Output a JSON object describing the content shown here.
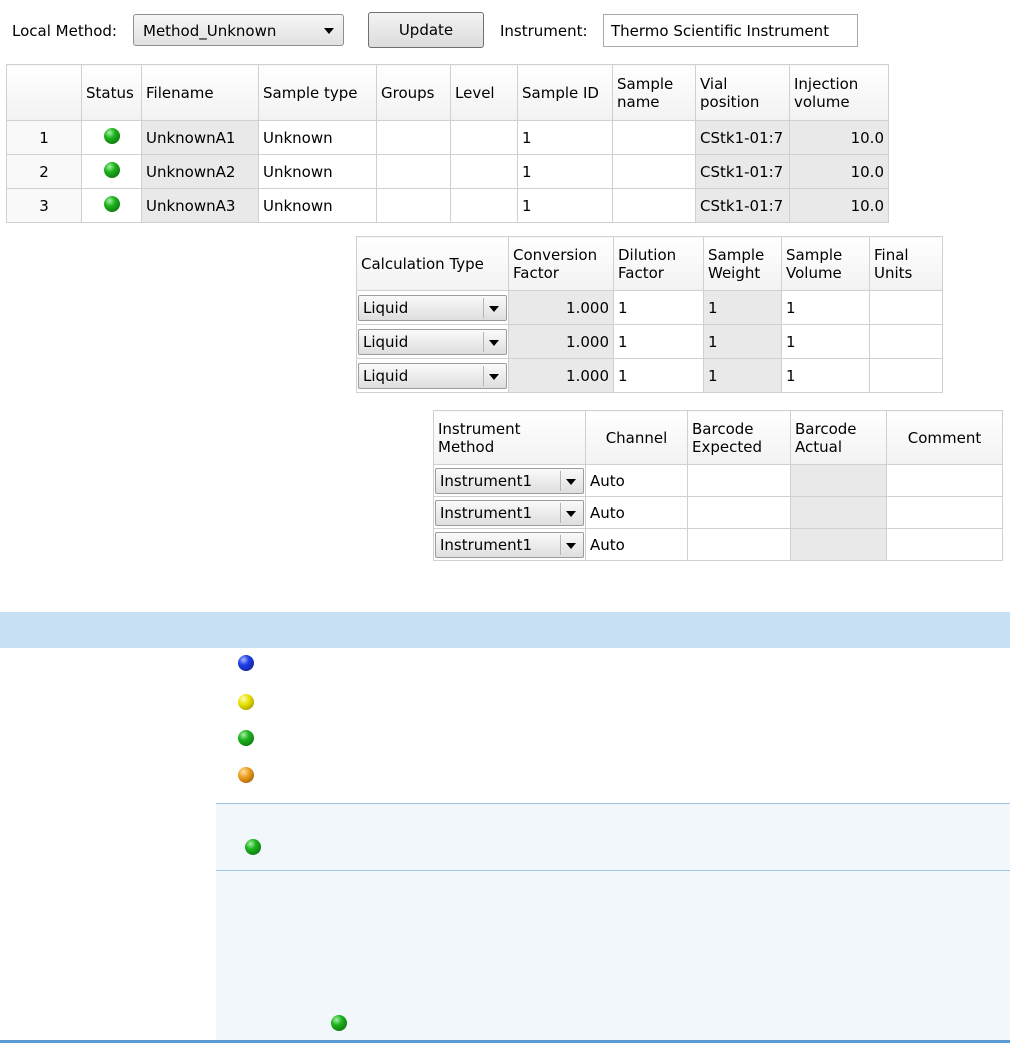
{
  "toolbar": {
    "local_method_label": "Local Method:",
    "local_method_value": "Method_Unknown",
    "update_label": "Update",
    "instrument_label": "Instrument:",
    "instrument_value": "Thermo Scientific Instrument"
  },
  "main_grid": {
    "headers": [
      "",
      "Status",
      "Filename",
      "Sample type",
      "Groups",
      "Level",
      "Sample ID",
      "Sample name",
      "Vial position",
      "Injection volume"
    ],
    "rows": [
      {
        "num": "1",
        "status": "green",
        "filename": "UnknownA1",
        "sample_type": "Unknown",
        "groups": "",
        "level": "",
        "sample_id": "1",
        "sample_name": "",
        "vial": "CStk1-01:7",
        "inj": "10.0"
      },
      {
        "num": "2",
        "status": "green",
        "filename": "UnknownA2",
        "sample_type": "Unknown",
        "groups": "",
        "level": "",
        "sample_id": "1",
        "sample_name": "",
        "vial": "CStk1-01:7",
        "inj": "10.0"
      },
      {
        "num": "3",
        "status": "green",
        "filename": "UnknownA3",
        "sample_type": "Unknown",
        "groups": "",
        "level": "",
        "sample_id": "1",
        "sample_name": "",
        "vial": "CStk1-01:7",
        "inj": "10.0"
      }
    ]
  },
  "calc_grid": {
    "headers": [
      "Calculation Type",
      "Conversion Factor",
      "Dilution Factor",
      "Sample Weight",
      "Sample Volume",
      "Final Units"
    ],
    "rows": [
      {
        "type": "Liquid",
        "conv": "1.000",
        "dil": "1",
        "weight": "1",
        "volume": "1",
        "units": ""
      },
      {
        "type": "Liquid",
        "conv": "1.000",
        "dil": "1",
        "weight": "1",
        "volume": "1",
        "units": ""
      },
      {
        "type": "Liquid",
        "conv": "1.000",
        "dil": "1",
        "weight": "1",
        "volume": "1",
        "units": ""
      }
    ]
  },
  "instr_grid": {
    "headers": [
      "Instrument Method",
      "Channel",
      "Barcode Expected",
      "Barcode Actual",
      "Comment"
    ],
    "rows": [
      {
        "method": "Instrument1",
        "channel": "Auto",
        "bc_exp": "",
        "bc_act": "",
        "comment": ""
      },
      {
        "method": "Instrument1",
        "channel": "Auto",
        "bc_exp": "",
        "bc_act": "",
        "comment": ""
      },
      {
        "method": "Instrument1",
        "channel": "Auto",
        "bc_exp": "",
        "bc_act": "",
        "comment": ""
      }
    ]
  },
  "legend": {
    "icons": [
      "blue-status-icon",
      "yellow-status-icon",
      "green-status-icon",
      "orange-status-icon"
    ]
  },
  "colors": {
    "accent_band": "#c7e0f4",
    "rule": "#5b9bd5"
  }
}
